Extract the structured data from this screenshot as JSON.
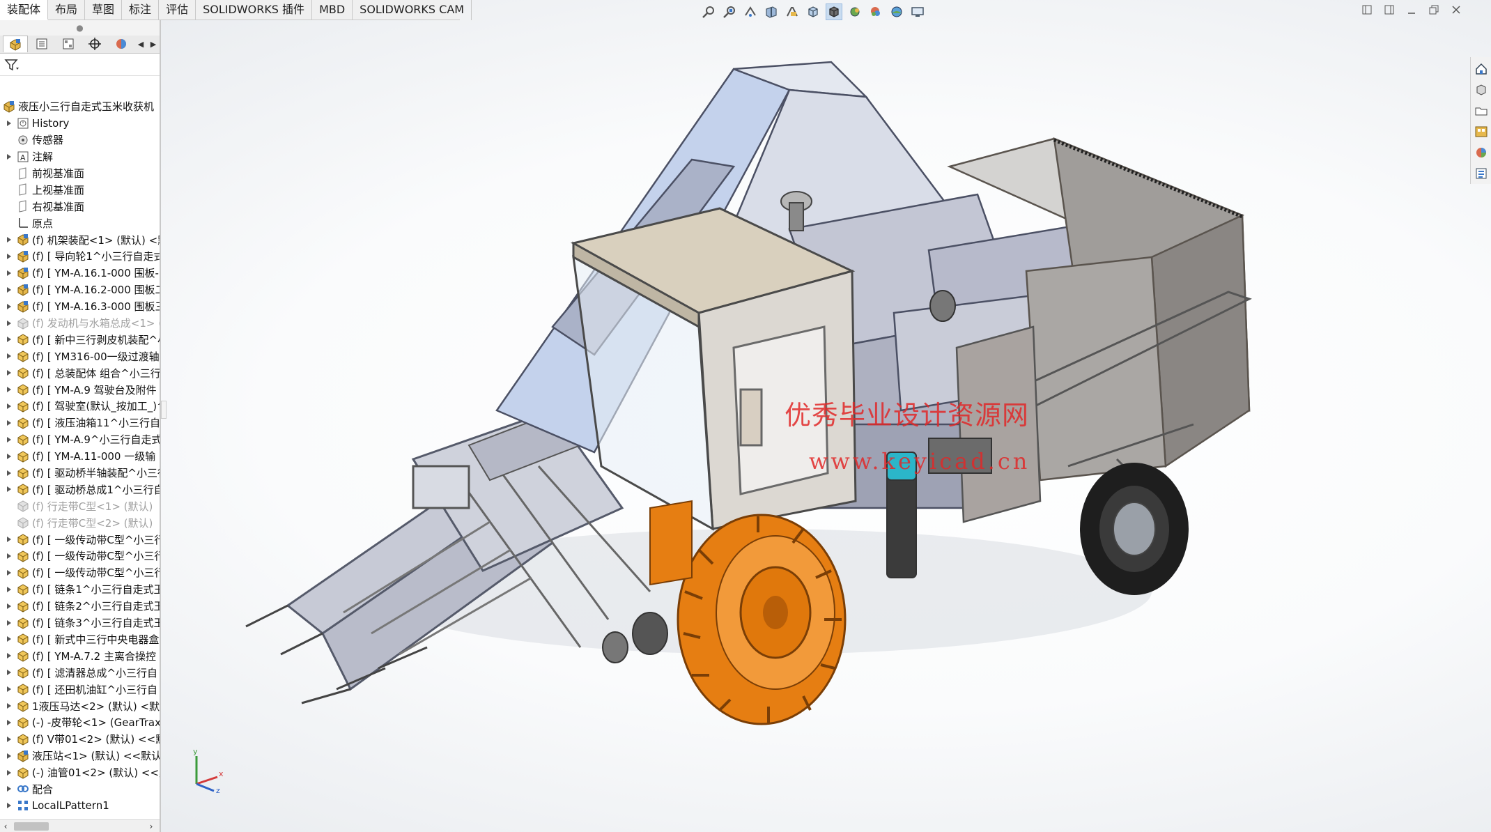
{
  "tabs": [
    {
      "label": "装配体",
      "active": true
    },
    {
      "label": "布局",
      "active": false
    },
    {
      "label": "草图",
      "active": false
    },
    {
      "label": "标注",
      "active": false
    },
    {
      "label": "评估",
      "active": false
    },
    {
      "label": "SOLIDWORKS 插件",
      "active": false
    },
    {
      "label": "MBD",
      "active": false
    },
    {
      "label": "SOLIDWORKS CAM",
      "active": false
    }
  ],
  "hud_icons": [
    "zoom-to-fit-icon",
    "zoom-area-icon",
    "previous-view-icon",
    "section-view-icon",
    "dynamic-annotation-icon",
    "view-orientation-icon",
    "display-style-icon",
    "hide-show-icon",
    "edit-appearance-icon",
    "apply-scene-icon",
    "view-settings-icon"
  ],
  "fm_tree": {
    "root": "液压小三行自走式玉米收获机（",
    "items": [
      {
        "label": "History",
        "icon": "history",
        "expand": true
      },
      {
        "label": "传感器",
        "icon": "sensor",
        "expand": false
      },
      {
        "label": "注解",
        "icon": "annotation",
        "expand": true
      },
      {
        "label": "前视基准面",
        "icon": "plane",
        "expand": false
      },
      {
        "label": "上视基准面",
        "icon": "plane",
        "expand": false
      },
      {
        "label": "右视基准面",
        "icon": "plane",
        "expand": false
      },
      {
        "label": "原点",
        "icon": "origin",
        "expand": false
      },
      {
        "label": "(f) 机架装配<1> (默认) <默",
        "icon": "subasm",
        "expand": true
      },
      {
        "label": "(f) [ 导向轮1^小三行自走式",
        "icon": "subasm",
        "expand": true
      },
      {
        "label": "(f) [ YM-A.16.1-000 围板-",
        "icon": "subasm",
        "expand": true
      },
      {
        "label": "(f) [ YM-A.16.2-000 围板二",
        "icon": "subasm",
        "expand": true
      },
      {
        "label": "(f) [ YM-A.16.3-000 围板三",
        "icon": "subasm",
        "expand": true
      },
      {
        "label": "(f) 发动机与水箱总成<1> (",
        "icon": "part-supp",
        "expand": true,
        "suppressed": true
      },
      {
        "label": "(f) [ 新中三行剥皮机装配^小",
        "icon": "part",
        "expand": true
      },
      {
        "label": "(f) [ YM316-00一级过渡轴",
        "icon": "part",
        "expand": true
      },
      {
        "label": "(f) [ 总装配体  组合^小三行",
        "icon": "part",
        "expand": true
      },
      {
        "label": "(f) [ YM-A.9 驾驶台及附件",
        "icon": "part",
        "expand": true
      },
      {
        "label": "(f) [ 驾驶室(默认_按加工_)^",
        "icon": "part",
        "expand": true
      },
      {
        "label": "(f) [ 液压油箱11^小三行自",
        "icon": "part",
        "expand": true
      },
      {
        "label": "(f) [ YM-A.9^小三行自走式",
        "icon": "part",
        "expand": true
      },
      {
        "label": "(f) [ YM-A.11-000 一级输",
        "icon": "part",
        "expand": true
      },
      {
        "label": "(f) [ 驱动桥半轴装配^小三行",
        "icon": "part",
        "expand": true
      },
      {
        "label": "(f) [ 驱动桥总成1^小三行自",
        "icon": "part",
        "expand": true
      },
      {
        "label": "(f) 行走带C型<1> (默认)",
        "icon": "part-supp",
        "expand": false,
        "suppressed": true
      },
      {
        "label": "(f) 行走带C型<2> (默认)",
        "icon": "part-supp",
        "expand": false,
        "suppressed": true
      },
      {
        "label": "(f) [ 一级传动带C型^小三行",
        "icon": "part",
        "expand": true
      },
      {
        "label": "(f) [ 一级传动带C型^小三行",
        "icon": "part",
        "expand": true
      },
      {
        "label": "(f) [ 一级传动带C型^小三行",
        "icon": "part",
        "expand": true
      },
      {
        "label": "(f) [ 链条1^小三行自走式玉",
        "icon": "part",
        "expand": true
      },
      {
        "label": "(f) [ 链条2^小三行自走式玉",
        "icon": "part",
        "expand": true
      },
      {
        "label": "(f) [ 链条3^小三行自走式玉",
        "icon": "part",
        "expand": true
      },
      {
        "label": "(f) [ 新式中三行中央电器盒",
        "icon": "part",
        "expand": true
      },
      {
        "label": "(f) [ YM-A.7.2 主离合操控",
        "icon": "part",
        "expand": true
      },
      {
        "label": "(f) [ 滤清器总成^小三行自",
        "icon": "part",
        "expand": true
      },
      {
        "label": "(f) [ 还田机油缸^小三行自",
        "icon": "part",
        "expand": true
      },
      {
        "label": "1液压马达<2> (默认) <默认",
        "icon": "part",
        "expand": true
      },
      {
        "label": "(-) -皮带轮<1> (GearTrax)",
        "icon": "part",
        "expand": true
      },
      {
        "label": "(f) V带01<2> (默认) <<默",
        "icon": "part",
        "expand": true
      },
      {
        "label": "液压站<1> (默认) <<默认",
        "icon": "subasm",
        "expand": true
      },
      {
        "label": "(-) 油管01<2> (默认) <<默",
        "icon": "part",
        "expand": true
      },
      {
        "label": "配合",
        "icon": "mates",
        "expand": true
      },
      {
        "label": "LocalLPattern1",
        "icon": "pattern",
        "expand": true
      }
    ]
  },
  "watermark": {
    "line1": "优秀毕业设计资源网",
    "line2": "www.keyicad.cn"
  },
  "triad": {
    "x": "x",
    "y": "y",
    "z": "z"
  },
  "colors": {
    "accent": "#1f63b5",
    "wheel": "#e67e12",
    "frame": "#8f94a8",
    "hopper": "#a7a6a4",
    "watermark": "#e12828"
  }
}
